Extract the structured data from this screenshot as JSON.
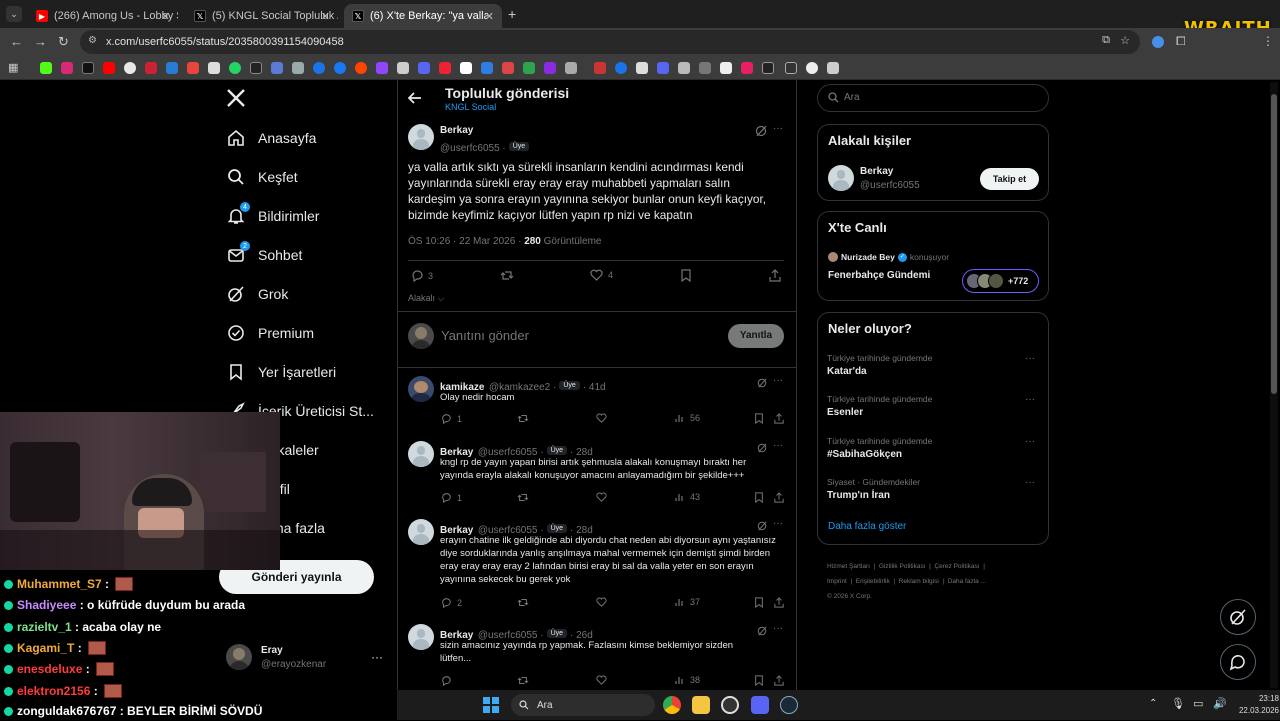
{
  "browser": {
    "tabs": [
      {
        "title": "(266) Among Us - Lobby Sp",
        "favicon": "youtube-icon",
        "color": "#ff0000"
      },
      {
        "title": "(5) KNGL Social Topluluk / X",
        "favicon": "x-icon",
        "color": "#000000"
      },
      {
        "title": "(6) X'te Berkay: \"ya valla artık s",
        "favicon": "x-icon",
        "color": "#000000"
      }
    ],
    "url": "x.com/userfc6055/status/2035800391154090458",
    "overlay_logo": "WRAITH"
  },
  "nav": {
    "items": [
      {
        "label": "Anasayfa",
        "icon": "home-icon"
      },
      {
        "label": "Keşfet",
        "icon": "search-icon"
      },
      {
        "label": "Bildirimler",
        "icon": "bell-icon",
        "badge": "4"
      },
      {
        "label": "Sohbet",
        "icon": "mail-icon",
        "badge": "2"
      },
      {
        "label": "Grok",
        "icon": "grok-icon"
      },
      {
        "label": "Premium",
        "icon": "verified-icon"
      },
      {
        "label": "Yer İşaretleri",
        "icon": "bookmark-icon"
      },
      {
        "label": "İçerik Üreticisi St...",
        "icon": "rocket-icon"
      },
      {
        "label": "Makaleler",
        "icon": "article-icon"
      },
      {
        "label": "Profil",
        "icon": "profile-icon"
      },
      {
        "label": "Daha fazla",
        "icon": "more-icon"
      }
    ],
    "post_button": "Gönderi yayınla",
    "account": {
      "name": "Eray",
      "handle": "@erayozkenar"
    }
  },
  "header": {
    "title": "Topluluk gönderisi",
    "subtitle": "KNGL Social"
  },
  "post": {
    "author": "Berkay",
    "handle": "@userfc6055",
    "role": "Üye",
    "text": "ya valla artık sıktı ya sürekli insanların kendini acındırması kendi yayınlarında sürekli eray eray eray muhabbeti yapmaları salın kardeşim ya sonra erayın yayınına sekiyor bunlar onun keyfi kaçıyor, bizimde keyfimiz kaçıyor lütfen yapın rp nizi ve kapatın",
    "time": "ÖS 10:26 · 22 Mar 2026 ·",
    "views": "280",
    "views_label": "Görüntüleme",
    "replies": "3",
    "likes": "4",
    "related_label": "Alakalı"
  },
  "compose": {
    "placeholder": "Yanıtını gönder",
    "button": "Yanıtla"
  },
  "replies": [
    {
      "name": "kamikaze",
      "handle": "@kamkazee2",
      "role": "Üye",
      "time": "· 41d",
      "text": "Olay nedir hocam",
      "replies": "1",
      "views": "56"
    },
    {
      "name": "Berkay",
      "handle": "@userfc6055",
      "role": "Üye",
      "time": "· 28d",
      "text": "kngl rp de yayın yapan birisi artık şehmusla alakalı konuşmayı bıraktı her yayında erayla alakalı konuşuyor amacını anlayamadığım bir şekilde+++",
      "replies": "1",
      "views": "43"
    },
    {
      "name": "Berkay",
      "handle": "@userfc6055",
      "role": "Üye",
      "time": "· 28d",
      "text": "erayın chatine ilk geldiğinde abi diyordu chat neden abi diyorsun aynı yaştanısız diye sorduklarında yanlış anşılmaya mahal vermemek için demişti şimdi birden eray eray eray eray 2 lafından birisi eray bi sal da valla yeter en son erayın yayınına sekecek bu gerek yok",
      "replies": "2",
      "views": "37"
    },
    {
      "name": "Berkay",
      "handle": "@userfc6055",
      "role": "Üye",
      "time": "· 26d",
      "text": "sizin amacınız yayında rp yapmak.  Fazlasını kimse beklemiyor sizden lütfen...",
      "replies": "",
      "views": "38"
    }
  ],
  "right": {
    "search_placeholder": "Ara",
    "people_title": "Alakalı kişiler",
    "person": {
      "name": "Berkay",
      "handle": "@userfc6055",
      "button": "Takip et"
    },
    "live_title": "X'te Canlı",
    "live": {
      "host": "Nurizade Bey",
      "status": "konuşuyor",
      "topic": "Fenerbahçe Gündemi",
      "count": "+772"
    },
    "trends_title": "Neler oluyor?",
    "trends": [
      {
        "category": "Türkiye tarihinde gündemde",
        "name": "Katar'da"
      },
      {
        "category": "Türkiye tarihinde gündemde",
        "name": "Esenler"
      },
      {
        "category": "Türkiye tarihinde gündemde",
        "name": "#SabihaGökçen"
      },
      {
        "category": "Siyaset · Gündemdekiler",
        "name": "Trump'ın İran"
      }
    ],
    "show_more": "Daha fazla göster",
    "footer_line1": [
      "Hizmet Şartları",
      "Gizlilik Politikası",
      "Çerez Politikası"
    ],
    "footer_line2": [
      "Imprint",
      "Erişilebilirlik",
      "Reklam bilgisi",
      "Daha fazla ..."
    ],
    "copyright": "© 2026 X Corp."
  },
  "chat": [
    {
      "user": "Muhammet_S7",
      "message": "",
      "color": "#f2a93b",
      "emote": true
    },
    {
      "user": "Shadiyeee",
      "message": "o küfrüde duydum bu arada",
      "color": "#c98bff",
      "emote": false
    },
    {
      "user": "razieltv_1",
      "message": "acaba olay ne",
      "color": "#7fe08a",
      "emote": false
    },
    {
      "user": "Kagami_T",
      "message": "",
      "color": "#f2a93b",
      "emote": true
    },
    {
      "user": "enesdeluxe",
      "message": "",
      "color": "#ff3b3b",
      "emote": true
    },
    {
      "user": "elektron2156",
      "message": "",
      "color": "#ff3b3b",
      "emote": true
    },
    {
      "user": "zonguldak676767",
      "message": "BEYLER BİRİMİ SÖVDÜ",
      "color": "#ffffff",
      "emote": false
    }
  ],
  "taskbar": {
    "search": "Ara",
    "time": "23:18",
    "date": "22.03.2026"
  }
}
